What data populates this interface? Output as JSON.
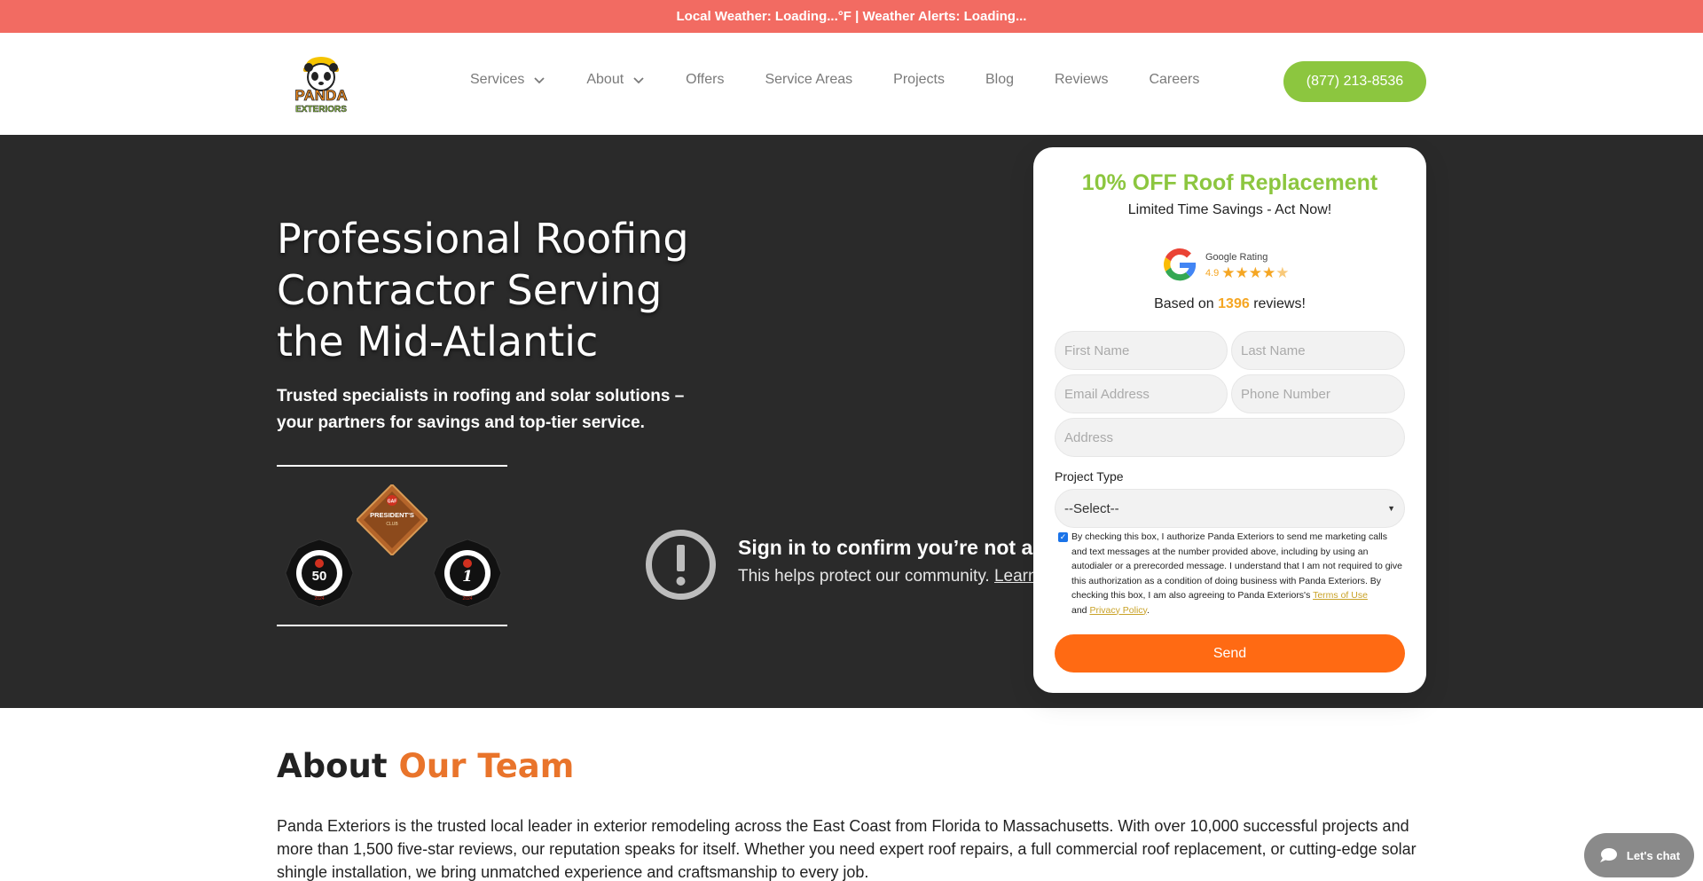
{
  "topbar": {
    "text": "Local Weather: Loading...°F | Weather Alerts: Loading..."
  },
  "header": {
    "logo_text": "PANDA EXTERIORS",
    "nav": [
      {
        "label": "Services",
        "has_dropdown": true
      },
      {
        "label": "About",
        "has_dropdown": true
      },
      {
        "label": "Offers",
        "has_dropdown": false
      },
      {
        "label": "Service Areas",
        "has_dropdown": false
      },
      {
        "label": "Projects",
        "has_dropdown": false
      },
      {
        "label": "Blog",
        "has_dropdown": false
      },
      {
        "label": "Reviews",
        "has_dropdown": false
      },
      {
        "label": "Careers",
        "has_dropdown": false
      }
    ],
    "phone": "(877) 213-8536"
  },
  "hero": {
    "title": "Professional Roofing Contractor Serving the Mid-Atlantic",
    "subtitle": "Trusted specialists in roofing and solar solutions – your partners for savings and top-tier service.",
    "badges": {
      "diamond_brand": "GAF",
      "diamond_title": "PRESIDENT'S",
      "diamond_sub": "CLUB",
      "left_circle_number": "50",
      "left_circle_year": "2024",
      "right_circle_number": "1",
      "right_circle_year": "2024"
    },
    "captcha": {
      "title": "Sign in to confirm you’re not a bot",
      "text": "This helps protect our community.",
      "link": "Learn more"
    }
  },
  "form": {
    "title": "10% OFF Roof Replacement",
    "subtitle": "Limited Time Savings - Act Now!",
    "google_label": "Google Rating",
    "rating": "4.9",
    "based_prefix": "Based on",
    "review_count": "1396",
    "based_suffix": "reviews!",
    "placeholders": {
      "first_name": "First Name",
      "last_name": "Last Name",
      "email": "Email Address",
      "phone": "Phone Number",
      "address": "Address"
    },
    "project_type_label": "Project Type",
    "project_type_value": "--Select--",
    "consent_checked": true,
    "consent_text": "By checking this box, I authorize Panda Exteriors to send me marketing calls and text messages at the number provided above, including by using an autodialer or a prerecorded message. I understand that I am not required to give this authorization as a condition of doing business with Panda Exteriors. By checking this box, I am also agreeing to Panda Exteriors's",
    "terms_link": "Terms of Use",
    "and_text": "and",
    "privacy_link": "Privacy Policy",
    "submit": "Send"
  },
  "about": {
    "title_plain": "About",
    "title_accent": "Our Team",
    "body": "Panda Exteriors is the trusted local leader in exterior remodeling across the East Coast from Florida to Massachusetts. With over 10,000 successful projects and more than 1,500 five-star reviews, our reputation speaks for itself. Whether you need expert roof repairs, a full commercial roof replacement, or cutting-edge solar shingle installation, we bring unmatched experience and craftsmanship to every job."
  },
  "chat": {
    "label": "Let's chat"
  },
  "colors": {
    "topbar": "#f26b62",
    "brand_green": "#8cc63f",
    "brand_orange": "#ff6a13",
    "accent_orange": "#e9742b",
    "hero_bg": "#2a2a2a",
    "star": "#f5a623"
  }
}
